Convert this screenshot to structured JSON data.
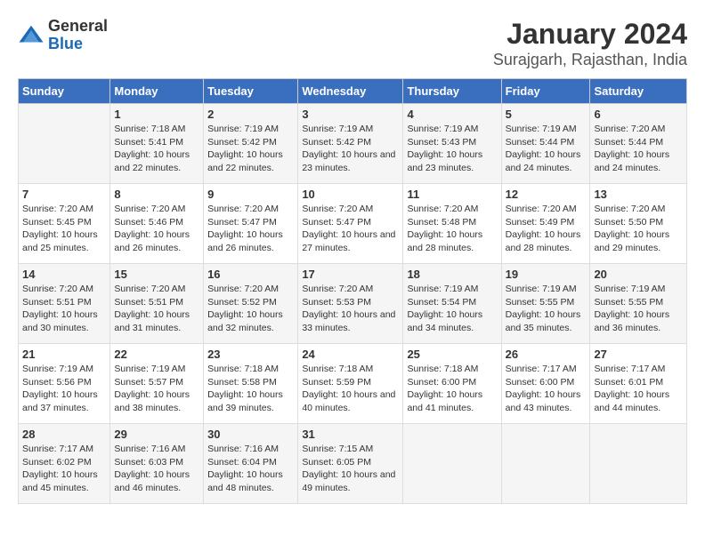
{
  "logo": {
    "general": "General",
    "blue": "Blue"
  },
  "title": "January 2024",
  "subtitle": "Surajgarh, Rajasthan, India",
  "headers": [
    "Sunday",
    "Monday",
    "Tuesday",
    "Wednesday",
    "Thursday",
    "Friday",
    "Saturday"
  ],
  "weeks": [
    [
      {
        "day": "",
        "sunrise": "",
        "sunset": "",
        "daylight": ""
      },
      {
        "day": "1",
        "sunrise": "Sunrise: 7:18 AM",
        "sunset": "Sunset: 5:41 PM",
        "daylight": "Daylight: 10 hours and 22 minutes."
      },
      {
        "day": "2",
        "sunrise": "Sunrise: 7:19 AM",
        "sunset": "Sunset: 5:42 PM",
        "daylight": "Daylight: 10 hours and 22 minutes."
      },
      {
        "day": "3",
        "sunrise": "Sunrise: 7:19 AM",
        "sunset": "Sunset: 5:42 PM",
        "daylight": "Daylight: 10 hours and 23 minutes."
      },
      {
        "day": "4",
        "sunrise": "Sunrise: 7:19 AM",
        "sunset": "Sunset: 5:43 PM",
        "daylight": "Daylight: 10 hours and 23 minutes."
      },
      {
        "day": "5",
        "sunrise": "Sunrise: 7:19 AM",
        "sunset": "Sunset: 5:44 PM",
        "daylight": "Daylight: 10 hours and 24 minutes."
      },
      {
        "day": "6",
        "sunrise": "Sunrise: 7:20 AM",
        "sunset": "Sunset: 5:44 PM",
        "daylight": "Daylight: 10 hours and 24 minutes."
      }
    ],
    [
      {
        "day": "7",
        "sunrise": "Sunrise: 7:20 AM",
        "sunset": "Sunset: 5:45 PM",
        "daylight": "Daylight: 10 hours and 25 minutes."
      },
      {
        "day": "8",
        "sunrise": "Sunrise: 7:20 AM",
        "sunset": "Sunset: 5:46 PM",
        "daylight": "Daylight: 10 hours and 26 minutes."
      },
      {
        "day": "9",
        "sunrise": "Sunrise: 7:20 AM",
        "sunset": "Sunset: 5:47 PM",
        "daylight": "Daylight: 10 hours and 26 minutes."
      },
      {
        "day": "10",
        "sunrise": "Sunrise: 7:20 AM",
        "sunset": "Sunset: 5:47 PM",
        "daylight": "Daylight: 10 hours and 27 minutes."
      },
      {
        "day": "11",
        "sunrise": "Sunrise: 7:20 AM",
        "sunset": "Sunset: 5:48 PM",
        "daylight": "Daylight: 10 hours and 28 minutes."
      },
      {
        "day": "12",
        "sunrise": "Sunrise: 7:20 AM",
        "sunset": "Sunset: 5:49 PM",
        "daylight": "Daylight: 10 hours and 28 minutes."
      },
      {
        "day": "13",
        "sunrise": "Sunrise: 7:20 AM",
        "sunset": "Sunset: 5:50 PM",
        "daylight": "Daylight: 10 hours and 29 minutes."
      }
    ],
    [
      {
        "day": "14",
        "sunrise": "Sunrise: 7:20 AM",
        "sunset": "Sunset: 5:51 PM",
        "daylight": "Daylight: 10 hours and 30 minutes."
      },
      {
        "day": "15",
        "sunrise": "Sunrise: 7:20 AM",
        "sunset": "Sunset: 5:51 PM",
        "daylight": "Daylight: 10 hours and 31 minutes."
      },
      {
        "day": "16",
        "sunrise": "Sunrise: 7:20 AM",
        "sunset": "Sunset: 5:52 PM",
        "daylight": "Daylight: 10 hours and 32 minutes."
      },
      {
        "day": "17",
        "sunrise": "Sunrise: 7:20 AM",
        "sunset": "Sunset: 5:53 PM",
        "daylight": "Daylight: 10 hours and 33 minutes."
      },
      {
        "day": "18",
        "sunrise": "Sunrise: 7:19 AM",
        "sunset": "Sunset: 5:54 PM",
        "daylight": "Daylight: 10 hours and 34 minutes."
      },
      {
        "day": "19",
        "sunrise": "Sunrise: 7:19 AM",
        "sunset": "Sunset: 5:55 PM",
        "daylight": "Daylight: 10 hours and 35 minutes."
      },
      {
        "day": "20",
        "sunrise": "Sunrise: 7:19 AM",
        "sunset": "Sunset: 5:55 PM",
        "daylight": "Daylight: 10 hours and 36 minutes."
      }
    ],
    [
      {
        "day": "21",
        "sunrise": "Sunrise: 7:19 AM",
        "sunset": "Sunset: 5:56 PM",
        "daylight": "Daylight: 10 hours and 37 minutes."
      },
      {
        "day": "22",
        "sunrise": "Sunrise: 7:19 AM",
        "sunset": "Sunset: 5:57 PM",
        "daylight": "Daylight: 10 hours and 38 minutes."
      },
      {
        "day": "23",
        "sunrise": "Sunrise: 7:18 AM",
        "sunset": "Sunset: 5:58 PM",
        "daylight": "Daylight: 10 hours and 39 minutes."
      },
      {
        "day": "24",
        "sunrise": "Sunrise: 7:18 AM",
        "sunset": "Sunset: 5:59 PM",
        "daylight": "Daylight: 10 hours and 40 minutes."
      },
      {
        "day": "25",
        "sunrise": "Sunrise: 7:18 AM",
        "sunset": "Sunset: 6:00 PM",
        "daylight": "Daylight: 10 hours and 41 minutes."
      },
      {
        "day": "26",
        "sunrise": "Sunrise: 7:17 AM",
        "sunset": "Sunset: 6:00 PM",
        "daylight": "Daylight: 10 hours and 43 minutes."
      },
      {
        "day": "27",
        "sunrise": "Sunrise: 7:17 AM",
        "sunset": "Sunset: 6:01 PM",
        "daylight": "Daylight: 10 hours and 44 minutes."
      }
    ],
    [
      {
        "day": "28",
        "sunrise": "Sunrise: 7:17 AM",
        "sunset": "Sunset: 6:02 PM",
        "daylight": "Daylight: 10 hours and 45 minutes."
      },
      {
        "day": "29",
        "sunrise": "Sunrise: 7:16 AM",
        "sunset": "Sunset: 6:03 PM",
        "daylight": "Daylight: 10 hours and 46 minutes."
      },
      {
        "day": "30",
        "sunrise": "Sunrise: 7:16 AM",
        "sunset": "Sunset: 6:04 PM",
        "daylight": "Daylight: 10 hours and 48 minutes."
      },
      {
        "day": "31",
        "sunrise": "Sunrise: 7:15 AM",
        "sunset": "Sunset: 6:05 PM",
        "daylight": "Daylight: 10 hours and 49 minutes."
      },
      {
        "day": "",
        "sunrise": "",
        "sunset": "",
        "daylight": ""
      },
      {
        "day": "",
        "sunrise": "",
        "sunset": "",
        "daylight": ""
      },
      {
        "day": "",
        "sunrise": "",
        "sunset": "",
        "daylight": ""
      }
    ]
  ]
}
